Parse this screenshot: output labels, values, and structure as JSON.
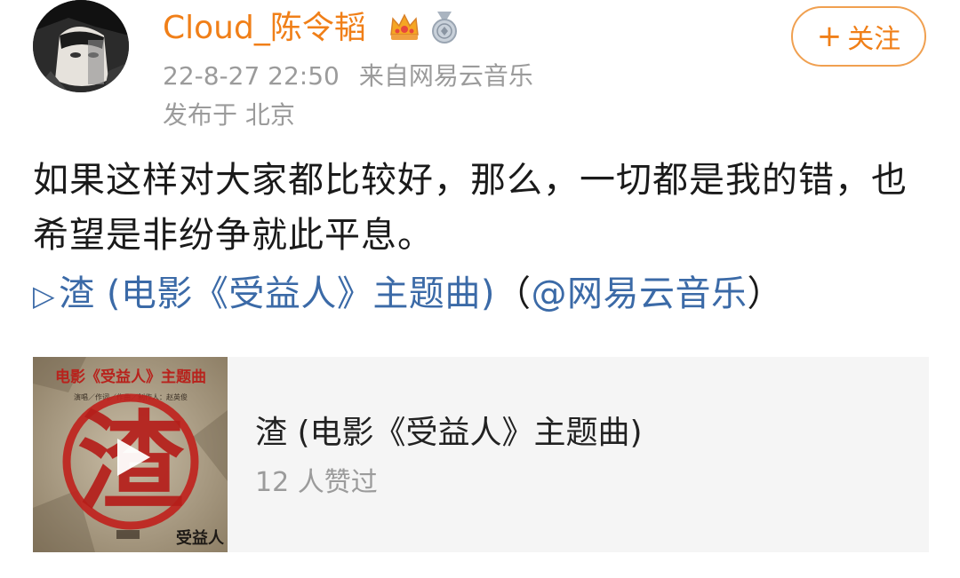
{
  "header": {
    "username": "Cloud_陈令韬",
    "timestamp": "22-8-27 22:50",
    "source": "来自网易云音乐",
    "location": "发布于 北京",
    "follow_label": "关注",
    "follow_icon": "plus-icon",
    "badges": [
      "crown-icon",
      "medal-icon"
    ]
  },
  "post": {
    "text": "如果这样对大家都比较好，那么，一切都是我的错，也希望是非纷争就此平息。",
    "music_link": {
      "play_symbol": "▷",
      "song": "渣 (电影《受益人》主题曲)",
      "open_paren": "（",
      "mention": "@网易云音乐",
      "close_paren": "）"
    }
  },
  "music_card": {
    "title": "渣 (电影《受益人》主题曲)",
    "likes": "12 人赞过",
    "cover": {
      "banner": "电影《受益人》主题曲",
      "credits": "演唱／作词／作曲／制作人：赵英俊",
      "big_char": "渣",
      "movie_title": "受益人",
      "accent_color": "#c0201c"
    }
  }
}
